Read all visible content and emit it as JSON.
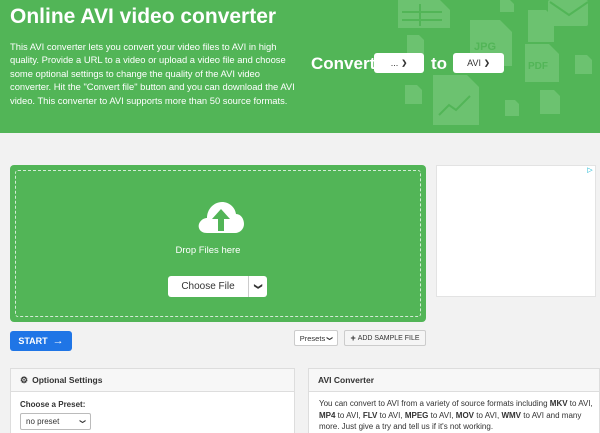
{
  "header": {
    "title": "Online AVI video converter",
    "description": "This AVI converter lets you convert your video files to AVI in high quality. Provide a URL to a video or upload a video file and choose some optional settings to change the quality of the AVI video converter. Hit the \"Convert file\" button and you can download the AVI video. This converter to AVI supports more than 50 source formats.",
    "convert_label": "Convert",
    "from_format": "...",
    "to_label": "to",
    "to_format": "AVI",
    "bg_color": "#52b557"
  },
  "upload": {
    "drop_text": "Drop Files here",
    "choose_label": "Choose File"
  },
  "actions": {
    "start_label": "START",
    "presets_label": "Presets",
    "sample_label": "ADD SAMPLE FILE"
  },
  "optional_settings": {
    "title": "Optional Settings",
    "preset_label": "Choose a Preset:",
    "preset_value": "no preset"
  },
  "info": {
    "title": "AVI Converter",
    "text_parts": [
      "You can convert to AVI from a variety of source formats including ",
      "MKV",
      " to AVI, ",
      "MP4",
      " to AVI, ",
      "FLV",
      " to AVI, ",
      "MPEG",
      " to AVI, ",
      "MOV",
      " to AVI, ",
      "WMV",
      " to AVI and many more. Just give a try and tell us if it's not working."
    ]
  },
  "colors": {
    "green": "#52b557",
    "start_blue": "#1f75e6"
  }
}
